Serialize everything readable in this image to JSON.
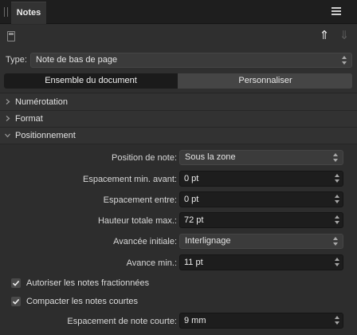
{
  "panel": {
    "tab_title": "Notes"
  },
  "toolbar": {
    "document_icon": "document-icon",
    "move_up_icon": "arrow-up-icon",
    "move_down_icon": "arrow-down-icon"
  },
  "type_row": {
    "label": "Type:",
    "value": "Note de bas de page"
  },
  "scope": {
    "options": [
      "Ensemble du document",
      "Personnaliser"
    ],
    "selected": "Ensemble du document"
  },
  "sections": [
    {
      "label": "Numérotation",
      "expanded": false
    },
    {
      "label": "Format",
      "expanded": false
    },
    {
      "label": "Positionnement",
      "expanded": true
    }
  ],
  "positioning": {
    "note_position": {
      "label": "Position de note:",
      "value": "Sous la zone"
    },
    "min_spacing_before": {
      "label": "Espacement min. avant:",
      "value": "0 pt"
    },
    "spacing_between": {
      "label": "Espacement entre:",
      "value": "0 pt"
    },
    "max_total_height": {
      "label": "Hauteur totale max.:",
      "value": "72 pt"
    },
    "initial_advance": {
      "label": "Avancée initiale:",
      "value": "Interlignage"
    },
    "min_advance": {
      "label": "Avance min.:",
      "value": "11 pt"
    },
    "allow_split_notes": {
      "label": "Autoriser les notes fractionnées",
      "checked": true
    },
    "compact_short_notes": {
      "label": "Compacter les notes courtes",
      "checked": true
    },
    "short_note_spacing": {
      "label": "Espacement de note courte:",
      "value": "9 mm"
    }
  },
  "colors": {
    "titlebar": "#1e1e1e",
    "panel": "#2f2f2f",
    "field": "#1d1d1d",
    "segment_active": "#1b1b1b",
    "segment_inactive": "#454545"
  }
}
